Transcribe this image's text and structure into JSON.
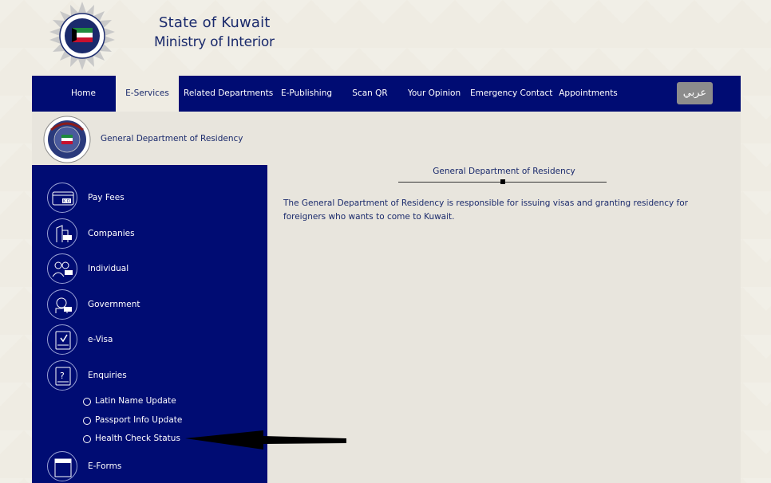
{
  "header": {
    "title_line1": "State of Kuwait",
    "title_line2": "Ministry of Interior"
  },
  "nav": {
    "items": [
      {
        "label": "Home"
      },
      {
        "label": "E-Services"
      },
      {
        "label": "Related Departments"
      },
      {
        "label": "E-Publishing"
      },
      {
        "label": "Scan QR"
      },
      {
        "label": "Your Opinion"
      },
      {
        "label": "Emergency Contact"
      },
      {
        "label": "Appointments"
      }
    ],
    "language_button": "عربي"
  },
  "department": {
    "name": "General Department of Residency"
  },
  "sidebar": {
    "items": [
      {
        "label": "Pay Fees",
        "icon": "card-kd-icon"
      },
      {
        "label": "Companies",
        "icon": "building-icon"
      },
      {
        "label": "Individual",
        "icon": "people-icon"
      },
      {
        "label": "Government",
        "icon": "government-icon"
      },
      {
        "label": "e-Visa",
        "icon": "visa-document-icon"
      },
      {
        "label": "Enquiries",
        "icon": "enquiry-document-icon"
      },
      {
        "label": "E-Forms",
        "icon": "eform-icon"
      }
    ],
    "subitems": [
      {
        "label": "Latin Name Update"
      },
      {
        "label": "Passport Info Update"
      },
      {
        "label": "Health Check Status"
      }
    ]
  },
  "content": {
    "title": "General Department of Residency",
    "text": "The General Department of Residency is responsible for issuing visas and granting residency for foreigners who wants to come to Kuwait."
  },
  "colors": {
    "navy": "#000c73",
    "background": "#efece3",
    "panel": "#e8e5dd",
    "button_gray": "#8c8c8c"
  }
}
